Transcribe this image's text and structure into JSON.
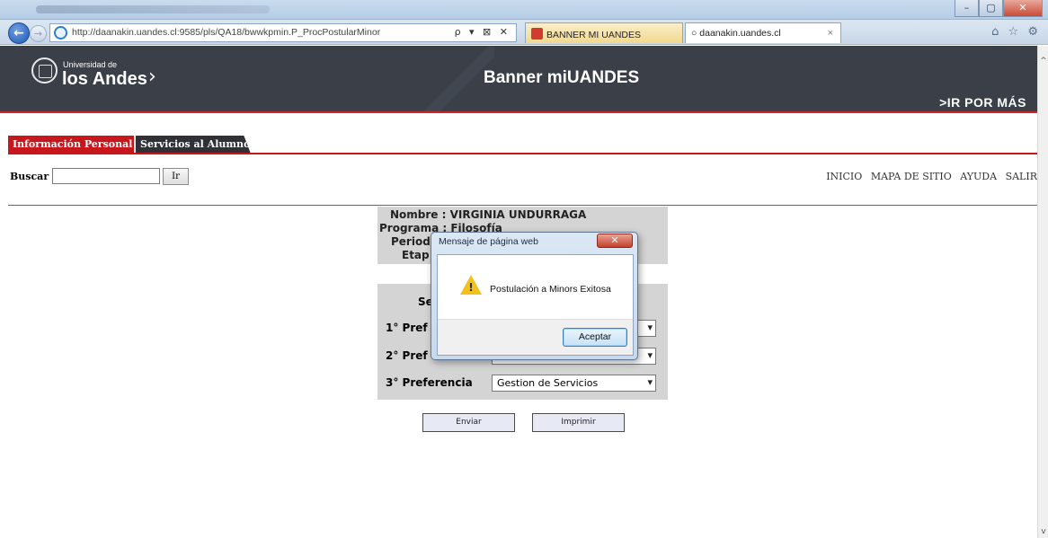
{
  "browser": {
    "url": "http://daanakin.uandes.cl:9585/pls/QA18/bwwkpmin.P_ProcPostularMinor",
    "url_bold_part": "uandes",
    "address_icons": "ρ ▾ ⊠ ✕",
    "tabs": [
      {
        "label": "BANNER MI UANDES"
      },
      {
        "label": "daanakin.uandes.cl",
        "close": "×"
      }
    ],
    "window_buttons": {
      "minimize": "–",
      "maximize": "▢",
      "close": "✕"
    },
    "right_icons": "⌂ ☆ ⚙"
  },
  "header": {
    "logo_small": "Universidad de",
    "logo_big": "los Andes",
    "logo_chevron": "›",
    "site_title": "Banner miUANDES",
    "cta": ">IR POR MÁS"
  },
  "page_tabs": [
    {
      "label": "Información Personal",
      "active": true
    },
    {
      "label": "Servicios al Alumno",
      "active": false
    }
  ],
  "search": {
    "label": "Buscar",
    "value": "",
    "button": "Ir"
  },
  "top_links": [
    "INICIO",
    "MAPA DE SITIO",
    "AYUDA",
    "SALIR"
  ],
  "student": {
    "nombre_line": "Nombre : VIRGINIA UNDURRAGA",
    "programa_line": "Programa : Filosofía",
    "periodo_label": "Period",
    "etapa_label": "Etap"
  },
  "preferences": {
    "section_label": "Se",
    "items": [
      {
        "label": "1° Pref",
        "value": ""
      },
      {
        "label": "2° Pref",
        "value": ""
      },
      {
        "label": "3° Preferencia",
        "value": "Gestion de Servicios"
      }
    ]
  },
  "buttons": {
    "send": "Enviar",
    "print": "Imprimir"
  },
  "dialog": {
    "title": "Mensaje de página web",
    "close": "✕",
    "message": "Postulación a Minors Exitosa",
    "ok": "Aceptar",
    "icon": "warning-icon"
  },
  "colors": {
    "header_bg": "#3a3f48",
    "accent_red": "#c8161d",
    "dark_tab": "#2f3136",
    "panel_gray": "#d4d4d4"
  }
}
